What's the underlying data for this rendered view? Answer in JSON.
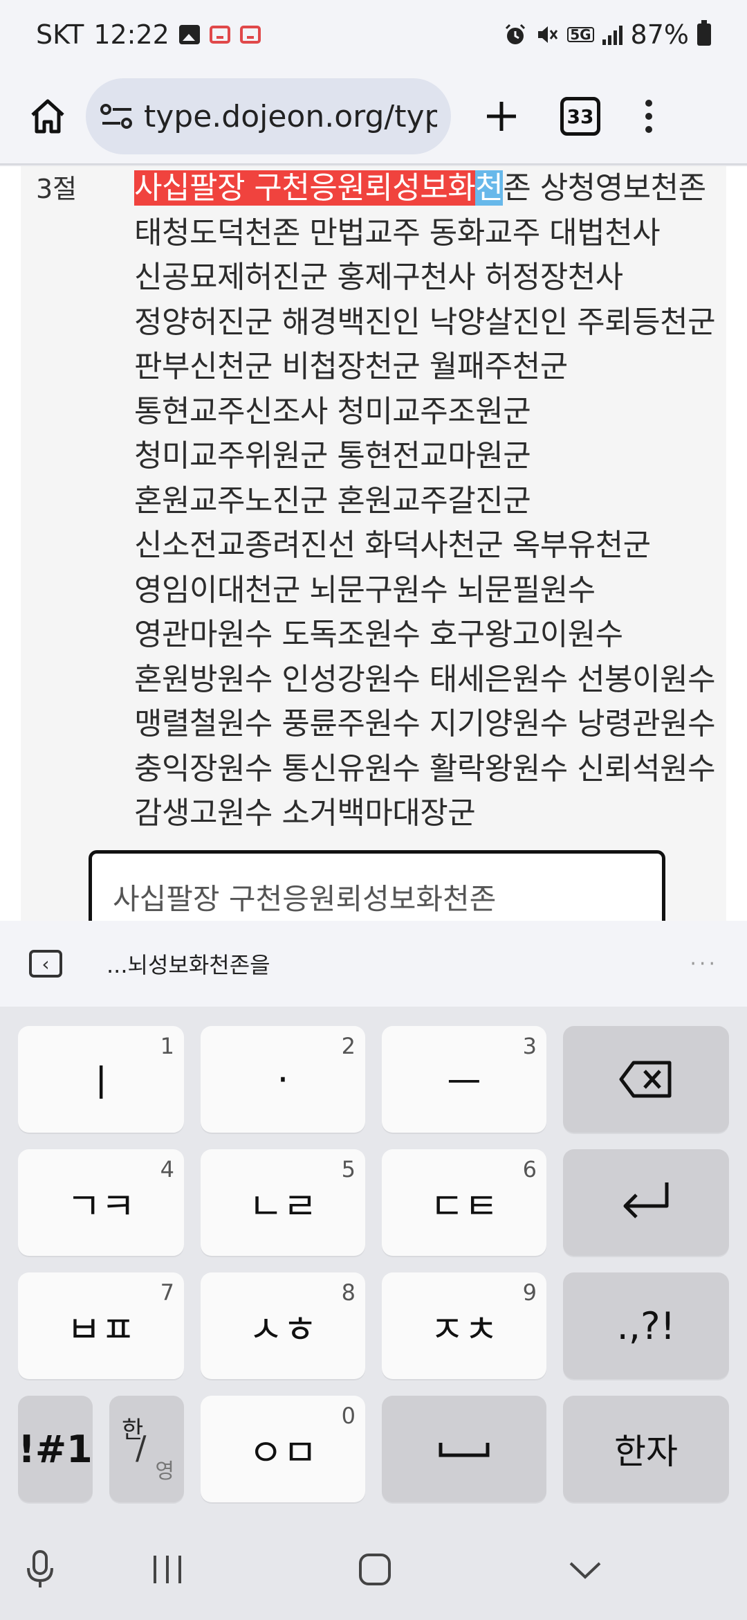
{
  "status_bar": {
    "carrier": "SKT",
    "time": "12:22",
    "network": "5G",
    "battery": "87%",
    "icons": [
      "image-icon",
      "calendar-icon",
      "calendar-icon",
      "alarm-icon",
      "mute-icon",
      "signal-icon",
      "battery-icon"
    ]
  },
  "browser": {
    "url": "type.dojeon.org/typ",
    "tab_count": "33"
  },
  "content": {
    "verse_label": "3절",
    "typed_part": "사십팔장 구천응원뢰성보화",
    "cursor_char": "천",
    "remaining_text": "존 상청영보천존 태청도덕천존 만법교주 동화교주 대법천사 신공묘제허진군 홍제구천사 허정장천사 정양허진군 해경백진인 낙양살진인 주뢰등천군 판부신천군 비첩장천군 월패주천군 통현교주신조사 청미교주조원군 청미교주위원군 통현전교마원군 혼원교주노진군 혼원교주갈진군 신소전교종려진선 화덕사천군 옥부유천군 영임이대천군 뇌문구원수 뇌문필원수 영관마원수 도독조원수 호구왕고이원수 혼원방원수 인성강원수 태세은원수 선봉이원수 맹렬철원수 풍륜주원수 지기양원수 낭령관원수 충익장원수 통신유원수 활락왕원수 신뢰석원수 감생고원수 소거백마대장군",
    "input_value": "사십팔장 구천응원뢰성보화천존"
  },
  "suggestion": {
    "text": "...뇌성보화천존을",
    "more": "···"
  },
  "keyboard": {
    "rows": [
      [
        {
          "label": "ㅣ",
          "num": "1"
        },
        {
          "label": "·",
          "num": "2"
        },
        {
          "label": "ㅡ",
          "num": "3"
        },
        {
          "label": "⌫",
          "num": ""
        }
      ],
      [
        {
          "label": "ㄱㅋ",
          "num": "4"
        },
        {
          "label": "ㄴㄹ",
          "num": "5"
        },
        {
          "label": "ㄷㅌ",
          "num": "6"
        },
        {
          "label": "↵",
          "num": ""
        }
      ],
      [
        {
          "label": "ㅂㅍ",
          "num": "7"
        },
        {
          "label": "ㅅㅎ",
          "num": "8"
        },
        {
          "label": "ㅈㅊ",
          "num": "9"
        },
        {
          "label": ".,?!",
          "num": ""
        }
      ]
    ],
    "symbols_label": "!#1",
    "lang_top": "한",
    "lang_bottom": "영",
    "om_label": "ㅇㅁ",
    "om_num": "0",
    "space_label": "␣",
    "hanja_label": "한자"
  },
  "colors": {
    "typed_highlight": "#f0433e",
    "cursor_highlight": "#67b8ea"
  }
}
